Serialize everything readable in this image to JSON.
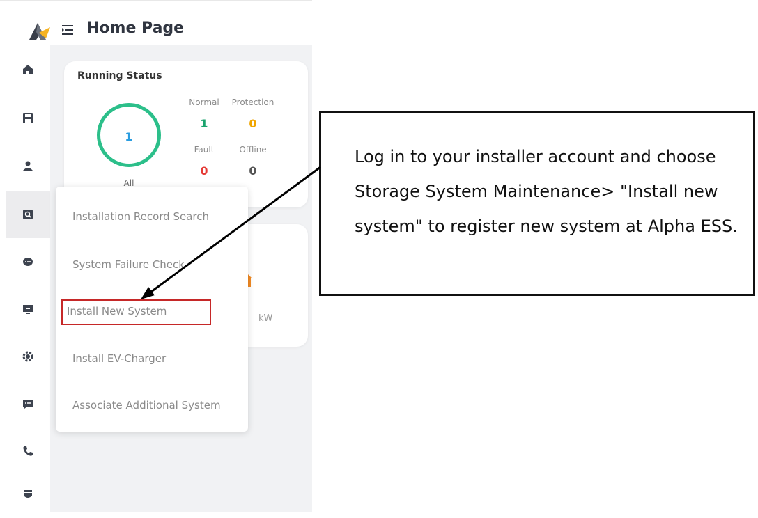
{
  "header": {
    "title": "Home Page",
    "logo_icon": "alpha-ess-logo",
    "menu_icon": "menu-fold-icon"
  },
  "sidebar": {
    "items": [
      {
        "name": "home",
        "icon": "home-icon",
        "active": true
      },
      {
        "name": "save",
        "icon": "save-icon"
      },
      {
        "name": "user",
        "icon": "user-icon"
      },
      {
        "name": "maintenance",
        "icon": "search-doc-icon"
      },
      {
        "name": "chat",
        "icon": "chat-bubble-icon"
      },
      {
        "name": "monitor",
        "icon": "monitor-icon"
      },
      {
        "name": "settings",
        "icon": "gear-icon"
      },
      {
        "name": "messages",
        "icon": "message-icon"
      },
      {
        "name": "phone",
        "icon": "phone-icon"
      },
      {
        "name": "more",
        "icon": "shield-icon"
      }
    ],
    "active_color": "#f5b323"
  },
  "running_status": {
    "title": "Running Status",
    "total": "1",
    "total_label": "All",
    "stats": [
      {
        "label": "Normal",
        "value": "1",
        "color": "#1aa36d"
      },
      {
        "label": "Protection",
        "value": "0",
        "color": "#f0a500"
      },
      {
        "label": "Fault",
        "value": "0",
        "color": "#e53935"
      },
      {
        "label": "Offline",
        "value": "0",
        "color": "#555555"
      }
    ]
  },
  "second_card": {
    "unit_fragment": "kW"
  },
  "dropdown": {
    "items": [
      "Installation Record Search",
      "System Failure Check",
      "Install New System",
      "Install EV-Charger",
      "Associate Additional System"
    ],
    "highlighted_index": 2,
    "highlight_color": "#c62828"
  },
  "callout": {
    "text": "Log in to your installer account and choose Storage System Maintenance> \"Install new system\" to register new system at Alpha ESS."
  }
}
